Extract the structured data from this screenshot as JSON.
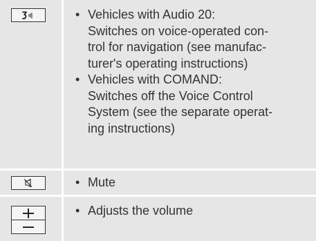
{
  "rows": [
    {
      "key_icon": "voice-control-icon",
      "items": [
        {
          "heading": "Vehicles with Audio 20:",
          "lines": [
            "Switches on voice-operated con-",
            "trol for navigation (see manufac-",
            "turer's operating instructions)"
          ]
        },
        {
          "heading": "Vehicles with COMAND:",
          "lines": [
            "Switches off the Voice Control",
            "System (see the separate operat-",
            "ing instructions)"
          ]
        }
      ]
    },
    {
      "key_icon": "mute-speaker-icon",
      "items": [
        {
          "heading": "Mute",
          "lines": []
        }
      ]
    },
    {
      "key_icon": "volume-plus-minus-icon",
      "items": [
        {
          "heading": "Adjusts the volume",
          "lines": []
        }
      ]
    }
  ],
  "bullet_char": "•"
}
